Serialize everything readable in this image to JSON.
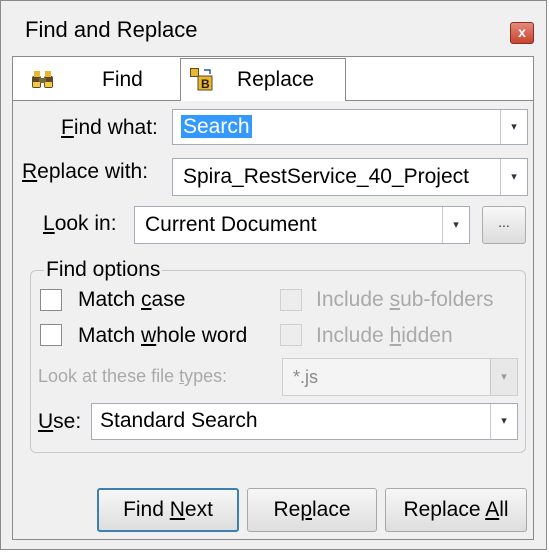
{
  "window": {
    "title": "Find and Replace",
    "close_glyph": "x"
  },
  "tabs": [
    {
      "label": "Find",
      "icon": "binoculars-icon",
      "active": false
    },
    {
      "label": "Replace",
      "icon": "replace-icon",
      "active": true
    }
  ],
  "fields": {
    "find_what": {
      "label_pre": "",
      "label_ul": "F",
      "label_post": "ind what:",
      "value": "Search"
    },
    "replace_with": {
      "label_pre": "",
      "label_ul": "R",
      "label_post": "eplace with:",
      "value": "Spira_RestService_40_Project"
    },
    "look_in": {
      "label_pre": "",
      "label_ul": "L",
      "label_post": "ook in:",
      "value": "Current Document",
      "browse_label": "..."
    }
  },
  "find_options": {
    "legend": "Find options",
    "match_case": {
      "pre": "Match ",
      "ul": "c",
      "post": "ase",
      "checked": false
    },
    "match_whole_word": {
      "pre": "Match ",
      "ul": "w",
      "post": "hole word",
      "checked": false
    },
    "include_subfolders": {
      "pre": "Include ",
      "ul": "s",
      "post": "ub-folders",
      "checked": false,
      "enabled": false
    },
    "include_hidden": {
      "pre": "Include ",
      "ul": "h",
      "post": "idden",
      "checked": false,
      "enabled": false
    },
    "file_types": {
      "pre": "Look at these file ",
      "ul": "t",
      "post": "ypes:",
      "value": "*.js",
      "enabled": false
    },
    "use": {
      "ul": "U",
      "post": "se:",
      "value": "Standard Search"
    }
  },
  "buttons": {
    "find_next": {
      "pre": "Find ",
      "ul": "N",
      "post": "ext"
    },
    "replace": {
      "pre": "Re",
      "ul": "p",
      "post": "lace"
    },
    "replace_all": {
      "pre": "Replace ",
      "ul": "A",
      "post": "ll"
    }
  },
  "dropdown_glyph": "▾"
}
